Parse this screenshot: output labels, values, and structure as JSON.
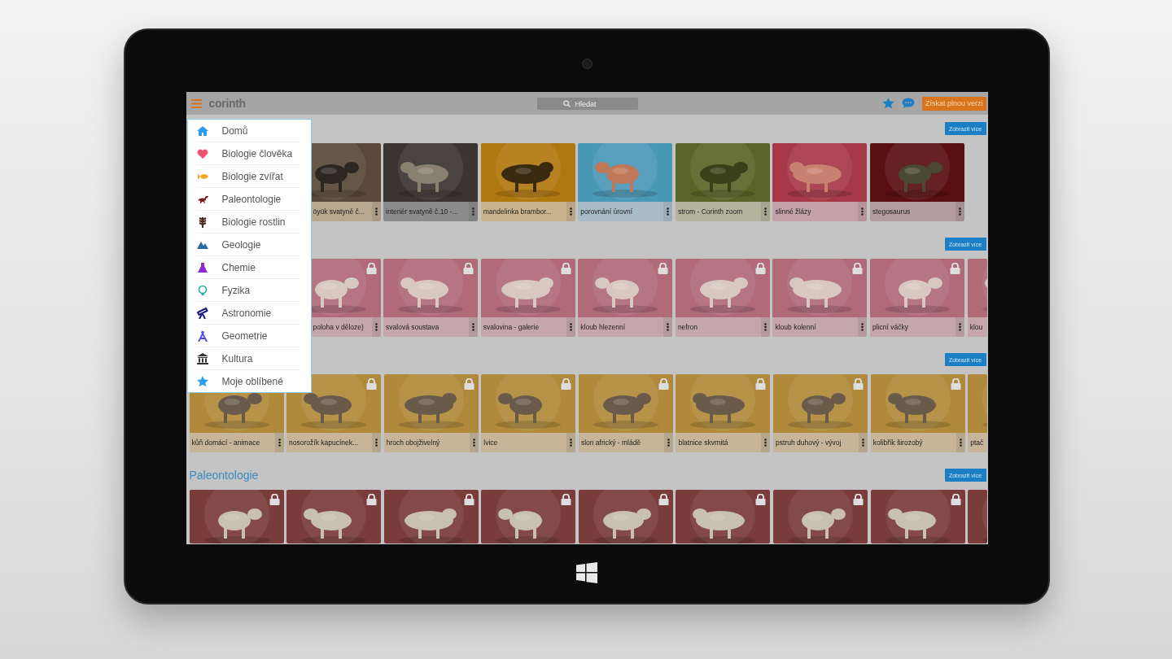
{
  "topbar": {
    "app_name": "corinth",
    "search": {
      "placeholder": "Hledat"
    },
    "upgrade_button": "Získat plnou verzi"
  },
  "menu": {
    "items": [
      "Domů",
      "Biologie člověka",
      "Biologie zvířat",
      "Paleontologie",
      "Biologie rostlin",
      "Geologie",
      "Chemie",
      "Fyzika",
      "Astronomie",
      "Geometrie",
      "Kultura",
      "Moje oblíbené"
    ]
  },
  "sections": [
    {
      "more_button": "Zobrazit více",
      "cards": [
        {
          "title": "öyük svatyně č...",
          "locked": false,
          "partial": true
        },
        {
          "title": "interiér svatyně č.10 -...",
          "locked": false
        },
        {
          "title": "mandelinka brambor...",
          "locked": false
        },
        {
          "title": "porovnání úrovní",
          "locked": false
        },
        {
          "title": "strom - Corinth zoom",
          "locked": false
        },
        {
          "title": "slinné žlázy",
          "locked": false
        },
        {
          "title": "stegosaurus",
          "locked": false
        }
      ]
    },
    {
      "more_button": "Zobrazit více",
      "cards": [
        {
          "title": "poloha v děloze)",
          "locked": true,
          "partial": true
        },
        {
          "title": "svalová soustava",
          "locked": true
        },
        {
          "title": "svalovina - galerie",
          "locked": true
        },
        {
          "title": "kloub hlezenní",
          "locked": true
        },
        {
          "title": "nefron",
          "locked": true
        },
        {
          "title": "kloub kolenní",
          "locked": true
        },
        {
          "title": "plicní váčky",
          "locked": true
        },
        {
          "title": "klou",
          "locked": false,
          "cut": true
        }
      ]
    },
    {
      "more_button": "Zobrazit více",
      "cards": [
        {
          "title": "kůň domácí - animace",
          "locked": false
        },
        {
          "title": "nosorožík kapucínek...",
          "locked": true
        },
        {
          "title": "hroch obojživelný",
          "locked": true
        },
        {
          "title": "lvice",
          "locked": true
        },
        {
          "title": "slon africký - mládě",
          "locked": true
        },
        {
          "title": "blatnice skvrnitá",
          "locked": true
        },
        {
          "title": "pstruh duhový - vývoj",
          "locked": true
        },
        {
          "title": "kolibřík širozobý",
          "locked": true
        },
        {
          "title": "ptač",
          "locked": false,
          "cut": true
        }
      ]
    },
    {
      "title": "Paleontologie",
      "more_button": "Zobrazit více",
      "cards": [
        {
          "locked": true
        },
        {
          "locked": true
        },
        {
          "locked": true
        },
        {
          "locked": true
        },
        {
          "locked": true
        },
        {
          "locked": true
        },
        {
          "locked": true
        },
        {
          "locked": true
        },
        {
          "locked": false,
          "cut": true
        }
      ]
    }
  ]
}
